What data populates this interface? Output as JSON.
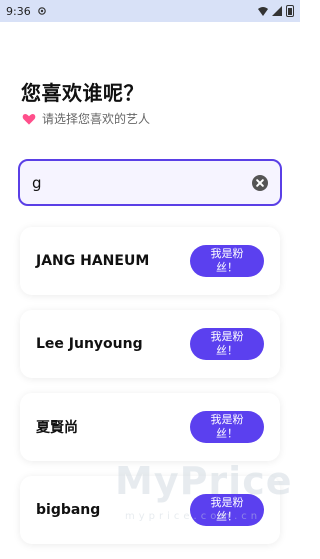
{
  "status_bar": {
    "time": "9:36",
    "icons": [
      "settings-icon",
      "wifi-icon",
      "signal-icon",
      "battery-icon"
    ]
  },
  "page": {
    "title": "您喜欢谁呢？",
    "subtitle": "请选择您喜欢的艺人",
    "subtitle_icon": "heart-icon"
  },
  "search": {
    "value": "g",
    "clear_icon": "clear-icon"
  },
  "artists": [
    {
      "name": "JANG HANEUM",
      "button_label": "我是粉丝！"
    },
    {
      "name": "Lee Junyoung",
      "button_label": "我是粉丝！"
    },
    {
      "name": "夏賢尚",
      "button_label": "我是粉丝！"
    },
    {
      "name": "bigbang",
      "button_label": "我是粉丝！"
    }
  ],
  "watermark": {
    "big": "MyPrice",
    "small": "myprice.com.cn"
  },
  "colors": {
    "accent": "#5b40ef",
    "status_bar_bg": "#d8e1f7",
    "heart": "#ff4f8b"
  }
}
